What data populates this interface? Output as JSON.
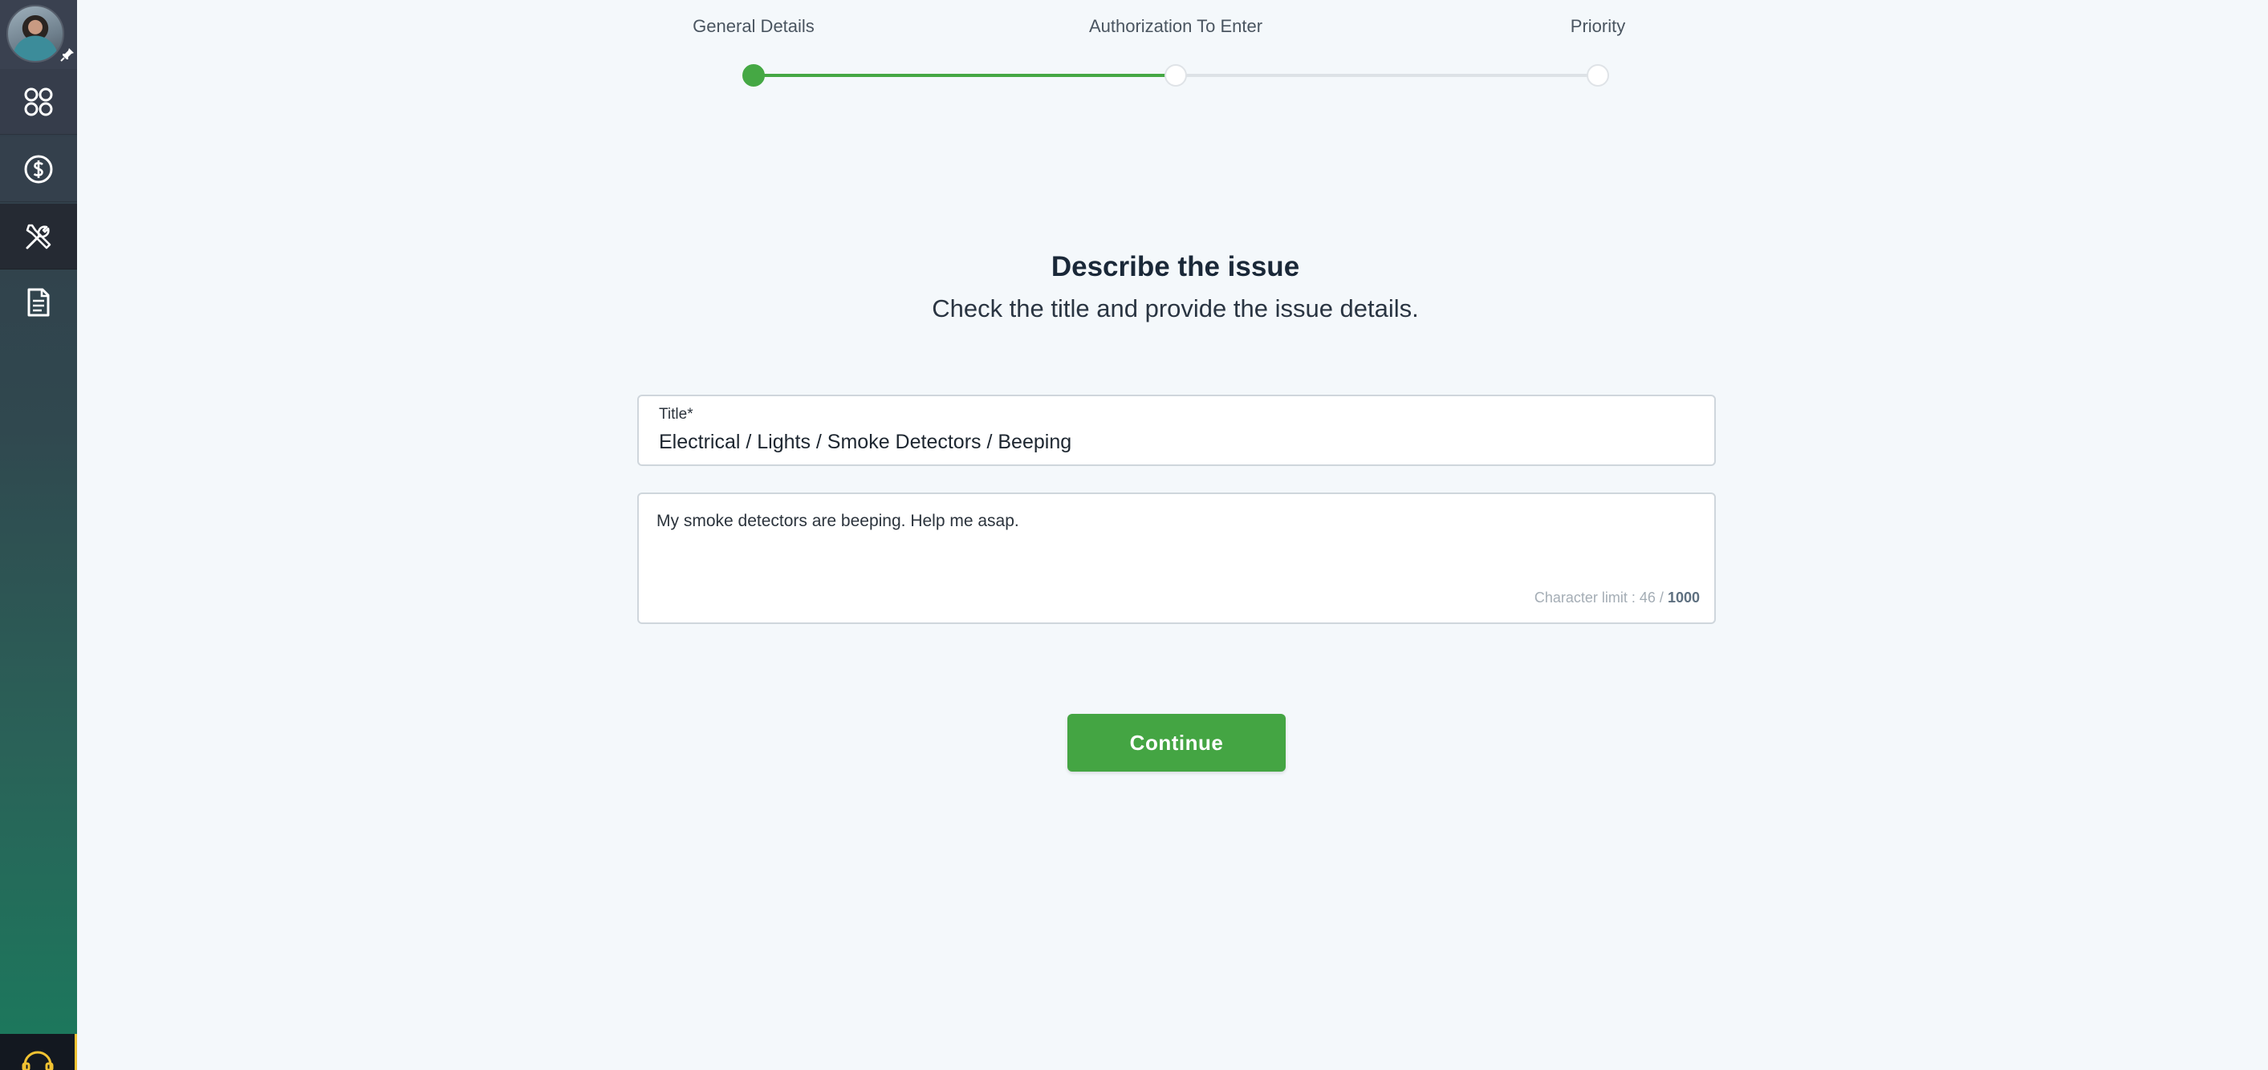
{
  "stepper": {
    "steps": [
      {
        "label": "General Details",
        "state": "done"
      },
      {
        "label": "Authorization To Enter",
        "state": "pending"
      },
      {
        "label": "Priority",
        "state": "pending"
      }
    ],
    "progress_fraction": 0.5,
    "accent_color": "#45a844"
  },
  "sidebar": {
    "items": [
      {
        "icon": "dashboard-icon"
      },
      {
        "icon": "dollar-icon"
      },
      {
        "icon": "tools-icon",
        "active": true
      },
      {
        "icon": "document-icon"
      }
    ],
    "support_icon": "headset-icon"
  },
  "main": {
    "title": "Describe the issue",
    "subtitle": "Check the title and provide the issue details."
  },
  "form": {
    "title_label": "Title*",
    "title_value": "Electrical / Lights / Smoke Detectors / Beeping",
    "description_value": "My smoke detectors are beeping. Help me asap.",
    "char_limit_prefix": "Character limit : 46 /",
    "char_limit_max": "1000",
    "continue_label": "Continue"
  }
}
